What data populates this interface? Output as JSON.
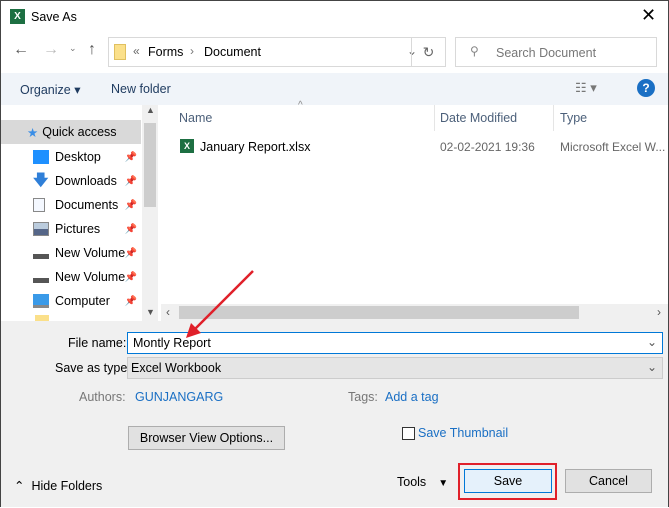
{
  "title": "Save As",
  "address": {
    "crumbs": [
      "Forms",
      "Document"
    ],
    "overflow": "«"
  },
  "search": {
    "placeholder": "Search Document"
  },
  "toolbar": {
    "organize": "Organize",
    "new_folder": "New folder"
  },
  "sidebar": {
    "items": [
      {
        "label": "Quick access",
        "icon": "star-icon",
        "selected": true
      },
      {
        "label": "Desktop",
        "icon": "desktop-icon"
      },
      {
        "label": "Downloads",
        "icon": "download-icon"
      },
      {
        "label": "Documents",
        "icon": "documents-icon"
      },
      {
        "label": "Pictures",
        "icon": "pictures-icon"
      },
      {
        "label": "New Volume",
        "icon": "drive-icon"
      },
      {
        "label": "New Volume",
        "icon": "drive-icon"
      },
      {
        "label": "Computer",
        "icon": "computer-icon"
      }
    ]
  },
  "columns": {
    "name": "Name",
    "date": "Date Modified",
    "type": "Type"
  },
  "files": [
    {
      "name": "January Report.xlsx",
      "date": "02-02-2021 19:36",
      "type": "Microsoft Excel W..."
    }
  ],
  "form": {
    "file_name_label": "File name:",
    "file_name_value": "Montly Report",
    "save_type_label": "Save as type:",
    "save_type_value": "Excel Workbook",
    "authors_label": "Authors:",
    "authors_value": "GUNJANGARG",
    "tags_label": "Tags:",
    "tags_value": "Add a tag",
    "browser_view": "Browser View Options...",
    "thumbnail": "Save Thumbnail",
    "thumbnail_checked": false
  },
  "footer": {
    "hide_folders": "Hide Folders",
    "tools": "Tools",
    "save": "Save",
    "cancel": "Cancel"
  },
  "colors": {
    "accent": "#0078d7",
    "annotation": "#e0202a",
    "link": "#1a6fc4"
  }
}
